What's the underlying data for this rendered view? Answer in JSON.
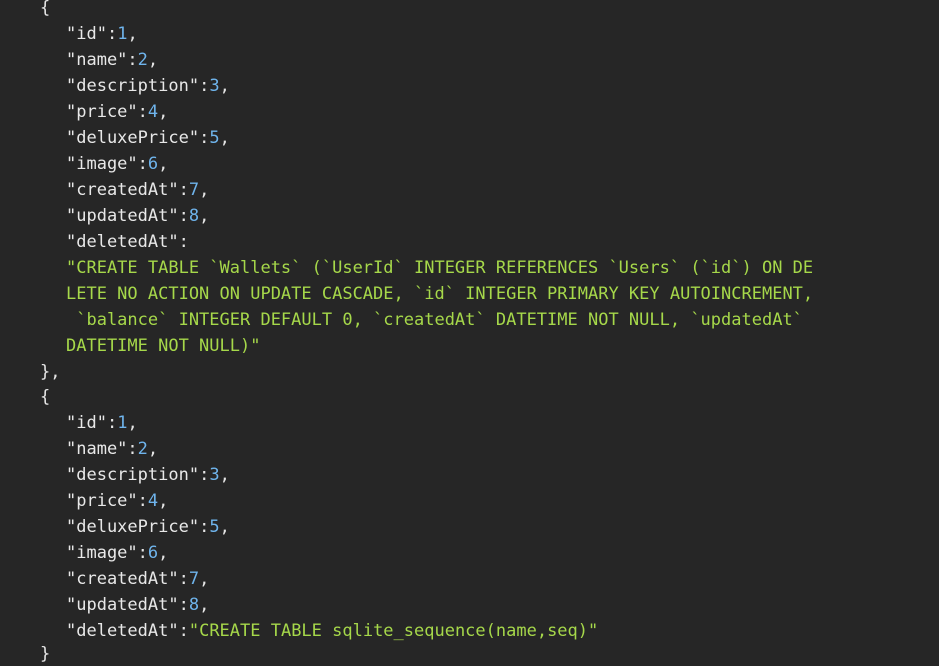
{
  "editor": {
    "background": "#262626",
    "colors": {
      "key": "#e8e8e8",
      "number": "#6fb4ec",
      "string": "#a6d84a",
      "punctuation": "#e6e6e6"
    },
    "objects": [
      {
        "open_brace": "{",
        "close_brace": "},",
        "fields": [
          {
            "key": "\"id\"",
            "sep": ":",
            "value": "1",
            "trail": ","
          },
          {
            "key": "\"name\"",
            "sep": ":",
            "value": "2",
            "trail": ","
          },
          {
            "key": "\"description\"",
            "sep": ":",
            "value": "3",
            "trail": ","
          },
          {
            "key": "\"price\"",
            "sep": ":",
            "value": "4",
            "trail": ","
          },
          {
            "key": "\"deluxePrice\"",
            "sep": ":",
            "value": "5",
            "trail": ","
          },
          {
            "key": "\"image\"",
            "sep": ":",
            "value": "6",
            "trail": ","
          },
          {
            "key": "\"createdAt\"",
            "sep": ":",
            "value": "7",
            "trail": ","
          },
          {
            "key": "\"updatedAt\"",
            "sep": ":",
            "value": "8",
            "trail": ","
          },
          {
            "key": "\"deletedAt\"",
            "sep": ":",
            "value": "",
            "trail": ""
          }
        ],
        "string_lines": [
          "\"CREATE TABLE `Wallets` (`UserId` INTEGER REFERENCES `Users` (`id`) ON DE",
          "LETE NO ACTION ON UPDATE CASCADE, `id` INTEGER PRIMARY KEY AUTOINCREMENT,",
          " `balance` INTEGER DEFAULT 0, `createdAt` DATETIME NOT NULL, `updatedAt`",
          "DATETIME NOT NULL)\""
        ]
      },
      {
        "open_brace": "{",
        "close_brace": "}",
        "fields": [
          {
            "key": "\"id\"",
            "sep": ":",
            "value": "1",
            "trail": ","
          },
          {
            "key": "\"name\"",
            "sep": ":",
            "value": "2",
            "trail": ","
          },
          {
            "key": "\"description\"",
            "sep": ":",
            "value": "3",
            "trail": ","
          },
          {
            "key": "\"price\"",
            "sep": ":",
            "value": "4",
            "trail": ","
          },
          {
            "key": "\"deluxePrice\"",
            "sep": ":",
            "value": "5",
            "trail": ","
          },
          {
            "key": "\"image\"",
            "sep": ":",
            "value": "6",
            "trail": ","
          },
          {
            "key": "\"createdAt\"",
            "sep": ":",
            "value": "7",
            "trail": ","
          },
          {
            "key": "\"updatedAt\"",
            "sep": ":",
            "value": "8",
            "trail": ","
          },
          {
            "key": "\"deletedAt\"",
            "sep": ":",
            "value": "\"CREATE TABLE sqlite_sequence(name,seq)\"",
            "trail": ""
          }
        ]
      }
    ]
  }
}
